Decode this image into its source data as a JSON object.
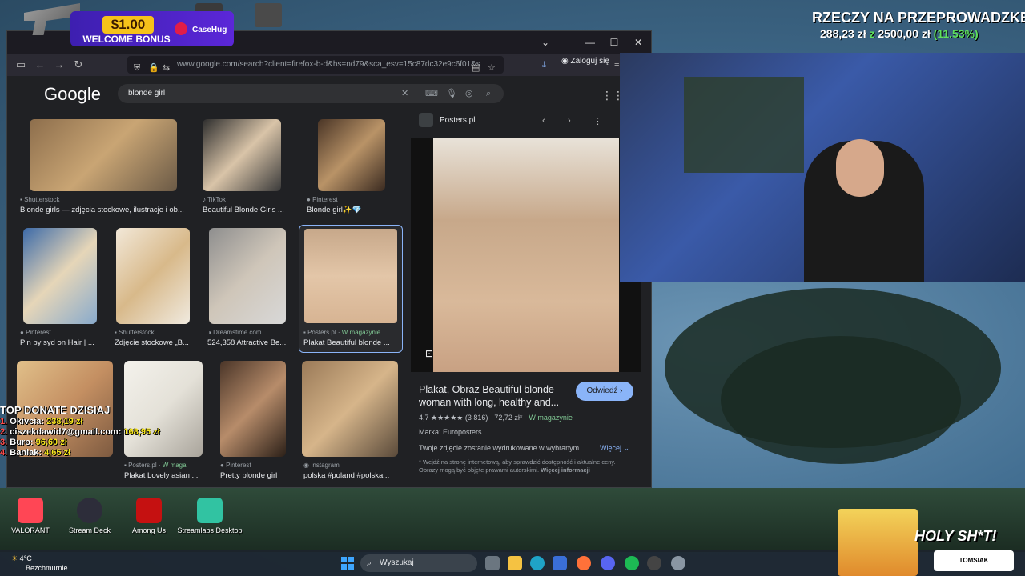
{
  "ad": {
    "amount": "$1.00",
    "subtitle": "WELCOME BONUS",
    "brand": "CaseHug"
  },
  "goal": {
    "title": "RZECZY NA PRZEPROWADZKE",
    "current": "288,23 zł",
    "separator": "z",
    "target": "2500,00 zł",
    "percent": "(11.53%)"
  },
  "browser": {
    "url": "www.google.com/search?client=firefox-b-d&hs=nd79&sca_esv=15c87dc32e9c6f01&s",
    "login_label": "Zaloguj się",
    "search_query": "blonde girl"
  },
  "results": [
    {
      "source": "Shutterstock",
      "title": "Blonde girls — zdjęcia stockowe, ilustracje i ob...",
      "color": "#c9a574"
    },
    {
      "source": "TikTok",
      "title": "Beautiful Blonde Girls ...",
      "color": "#d9c4a8"
    },
    {
      "source": "Pinterest",
      "title": "Blonde girl✨💎",
      "color": "#b99367"
    },
    {
      "source": "Pinterest",
      "title": "Pin by syd on Hair | ...",
      "color": "#e6d6b8"
    },
    {
      "source": "Shutterstock",
      "title": "Zdjęcie stockowe „B...",
      "color": "#d8b98a"
    },
    {
      "source": "Dreamstime.com",
      "title": "524,358 Attractive Be...",
      "color": "#cfc6b9"
    },
    {
      "source": "Posters.pl",
      "stock": "W magazynie",
      "title": "Plakat Beautiful blonde ...",
      "color": "#c7a88a"
    },
    {
      "source": "",
      "title": "",
      "color": "#e1c08a"
    },
    {
      "source": "Posters.pl",
      "stock": "W maga",
      "title": "Plakat Lovely asian ...",
      "color": "#e4e1d8"
    },
    {
      "source": "Pinterest",
      "title": "Pretty blonde girl",
      "color": "#b78c6a"
    },
    {
      "source": "Instagram",
      "title": "polska #poland #polska...",
      "color": "#d6b58a"
    }
  ],
  "panel": {
    "site": "Posters.pl",
    "title": "Plakat, Obraz Beautiful blonde woman with long, healthy and...",
    "visit_label": "Odwiedź ›",
    "rating": "4,7 ★★★★★ (3 816)",
    "price": "72,72 zł*",
    "stock": "W magazynie",
    "brand": "Marka: Europosters",
    "description": "Twoje zdjęcie zostanie wydrukowane w wybranym...",
    "more": "Więcej ⌄",
    "note": "* Wejdź na stronę internetową, aby sprawdzić dostępność i aktualne ceny. Obrazy mogą być objęte prawami autorskimi.",
    "note_link": "Więcej informacji"
  },
  "donations": {
    "title": "TOP DONATE DZISIAJ",
    "rows": [
      {
        "num": "1.",
        "name": "Okivcia:",
        "amount": "238,19 zł"
      },
      {
        "num": "2.",
        "name": "ciszekdawid7@gmail.com:",
        "amount": "168,95 zł"
      },
      {
        "num": "3.",
        "name": "Buro:",
        "amount": "96,60 zł"
      },
      {
        "num": "4.",
        "name": "Baniak:",
        "amount": "4,65 zł"
      }
    ]
  },
  "desktop_icons": [
    {
      "label": "VALORANT",
      "color": "#ff4655"
    },
    {
      "label": "Stream Deck",
      "color": "#2d2d3a"
    },
    {
      "label": "Among Us",
      "color": "#c51111"
    },
    {
      "label": "Streamlabs Desktop",
      "color": "#31c3a2"
    }
  ],
  "taskbar": {
    "weather_temp": "4°C",
    "weather_desc": "Bezchmurnie",
    "search_placeholder": "Wyszukaj"
  },
  "holy": {
    "text": "HOLY SH*T!",
    "sub": "TOMSIAK"
  }
}
